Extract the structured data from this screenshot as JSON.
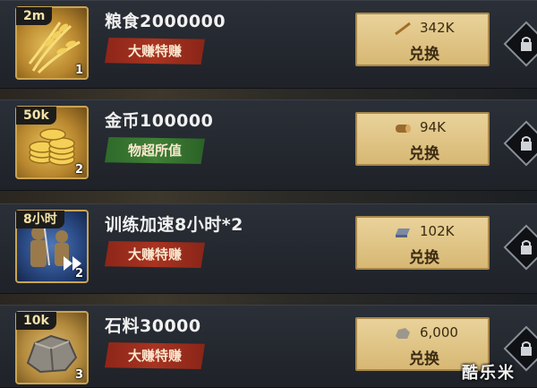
{
  "items": [
    {
      "amount_tag": "2m",
      "count": "1",
      "title": "粮食2000000",
      "badge": "大赚特赚",
      "badge_color": "red",
      "price": "342K",
      "button": "兑换",
      "icon": "wheat-icon",
      "price_icon": "horn-icon"
    },
    {
      "amount_tag": "50k",
      "count": "2",
      "title": "金币100000",
      "badge": "物超所值",
      "badge_color": "green",
      "price": "94K",
      "button": "兑换",
      "icon": "gold-coins-icon",
      "price_icon": "wood-log-icon"
    },
    {
      "amount_tag": "8小时",
      "count": "2",
      "title": "训练加速8小时*2",
      "badge": "大赚特赚",
      "badge_color": "red",
      "price": "102K",
      "button": "兑换",
      "icon": "soldiers-speedup-icon",
      "price_icon": "iron-ingot-icon"
    },
    {
      "amount_tag": "10k",
      "count": "3",
      "title": "石料30000",
      "badge": "大赚特赚",
      "badge_color": "red",
      "price": "6,000",
      "button": "兑换",
      "icon": "stone-ore-icon",
      "price_icon": "stone-icon"
    }
  ],
  "watermark": "酷乐米",
  "colors": {
    "gold_border": "#c9a452",
    "red_badge": "#a83421",
    "green_badge": "#3f7f36",
    "button_bg": "#e9d29a"
  }
}
